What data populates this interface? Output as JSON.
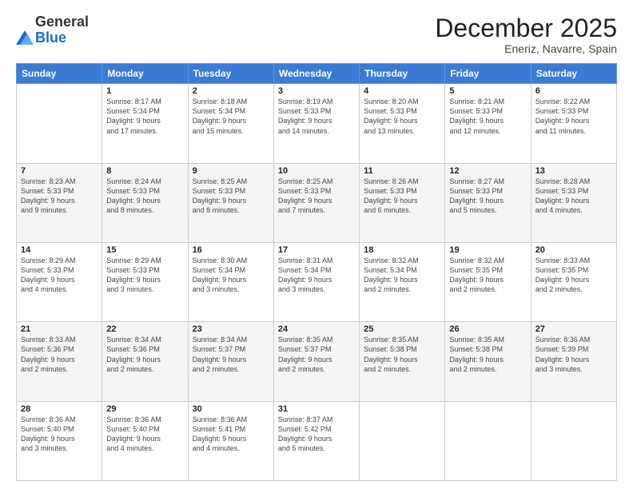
{
  "header": {
    "logo_general": "General",
    "logo_blue": "Blue",
    "month_title": "December 2025",
    "location": "Eneriz, Navarre, Spain"
  },
  "days_of_week": [
    "Sunday",
    "Monday",
    "Tuesday",
    "Wednesday",
    "Thursday",
    "Friday",
    "Saturday"
  ],
  "weeks": [
    [
      {
        "day": "",
        "info": ""
      },
      {
        "day": "1",
        "info": "Sunrise: 8:17 AM\nSunset: 5:34 PM\nDaylight: 9 hours\nand 17 minutes."
      },
      {
        "day": "2",
        "info": "Sunrise: 8:18 AM\nSunset: 5:34 PM\nDaylight: 9 hours\nand 15 minutes."
      },
      {
        "day": "3",
        "info": "Sunrise: 8:19 AM\nSunset: 5:33 PM\nDaylight: 9 hours\nand 14 minutes."
      },
      {
        "day": "4",
        "info": "Sunrise: 8:20 AM\nSunset: 5:33 PM\nDaylight: 9 hours\nand 13 minutes."
      },
      {
        "day": "5",
        "info": "Sunrise: 8:21 AM\nSunset: 5:33 PM\nDaylight: 9 hours\nand 12 minutes."
      },
      {
        "day": "6",
        "info": "Sunrise: 8:22 AM\nSunset: 5:33 PM\nDaylight: 9 hours\nand 11 minutes."
      }
    ],
    [
      {
        "day": "7",
        "info": "Sunrise: 8:23 AM\nSunset: 5:33 PM\nDaylight: 9 hours\nand 9 minutes."
      },
      {
        "day": "8",
        "info": "Sunrise: 8:24 AM\nSunset: 5:33 PM\nDaylight: 9 hours\nand 8 minutes."
      },
      {
        "day": "9",
        "info": "Sunrise: 8:25 AM\nSunset: 5:33 PM\nDaylight: 9 hours\nand 8 minutes."
      },
      {
        "day": "10",
        "info": "Sunrise: 8:25 AM\nSunset: 5:33 PM\nDaylight: 9 hours\nand 7 minutes."
      },
      {
        "day": "11",
        "info": "Sunrise: 8:26 AM\nSunset: 5:33 PM\nDaylight: 9 hours\nand 6 minutes."
      },
      {
        "day": "12",
        "info": "Sunrise: 8:27 AM\nSunset: 5:33 PM\nDaylight: 9 hours\nand 5 minutes."
      },
      {
        "day": "13",
        "info": "Sunrise: 8:28 AM\nSunset: 5:33 PM\nDaylight: 9 hours\nand 4 minutes."
      }
    ],
    [
      {
        "day": "14",
        "info": "Sunrise: 8:29 AM\nSunset: 5:33 PM\nDaylight: 9 hours\nand 4 minutes."
      },
      {
        "day": "15",
        "info": "Sunrise: 8:29 AM\nSunset: 5:33 PM\nDaylight: 9 hours\nand 3 minutes."
      },
      {
        "day": "16",
        "info": "Sunrise: 8:30 AM\nSunset: 5:34 PM\nDaylight: 9 hours\nand 3 minutes."
      },
      {
        "day": "17",
        "info": "Sunrise: 8:31 AM\nSunset: 5:34 PM\nDaylight: 9 hours\nand 3 minutes."
      },
      {
        "day": "18",
        "info": "Sunrise: 8:32 AM\nSunset: 5:34 PM\nDaylight: 9 hours\nand 2 minutes."
      },
      {
        "day": "19",
        "info": "Sunrise: 8:32 AM\nSunset: 5:35 PM\nDaylight: 9 hours\nand 2 minutes."
      },
      {
        "day": "20",
        "info": "Sunrise: 8:33 AM\nSunset: 5:35 PM\nDaylight: 9 hours\nand 2 minutes."
      }
    ],
    [
      {
        "day": "21",
        "info": "Sunrise: 8:33 AM\nSunset: 5:36 PM\nDaylight: 9 hours\nand 2 minutes."
      },
      {
        "day": "22",
        "info": "Sunrise: 8:34 AM\nSunset: 5:36 PM\nDaylight: 9 hours\nand 2 minutes."
      },
      {
        "day": "23",
        "info": "Sunrise: 8:34 AM\nSunset: 5:37 PM\nDaylight: 9 hours\nand 2 minutes."
      },
      {
        "day": "24",
        "info": "Sunrise: 8:35 AM\nSunset: 5:37 PM\nDaylight: 9 hours\nand 2 minutes."
      },
      {
        "day": "25",
        "info": "Sunrise: 8:35 AM\nSunset: 5:38 PM\nDaylight: 9 hours\nand 2 minutes."
      },
      {
        "day": "26",
        "info": "Sunrise: 8:35 AM\nSunset: 5:38 PM\nDaylight: 9 hours\nand 2 minutes."
      },
      {
        "day": "27",
        "info": "Sunrise: 8:36 AM\nSunset: 5:39 PM\nDaylight: 9 hours\nand 3 minutes."
      }
    ],
    [
      {
        "day": "28",
        "info": "Sunrise: 8:36 AM\nSunset: 5:40 PM\nDaylight: 9 hours\nand 3 minutes."
      },
      {
        "day": "29",
        "info": "Sunrise: 8:36 AM\nSunset: 5:40 PM\nDaylight: 9 hours\nand 4 minutes."
      },
      {
        "day": "30",
        "info": "Sunrise: 8:36 AM\nSunset: 5:41 PM\nDaylight: 9 hours\nand 4 minutes."
      },
      {
        "day": "31",
        "info": "Sunrise: 8:37 AM\nSunset: 5:42 PM\nDaylight: 9 hours\nand 5 minutes."
      },
      {
        "day": "",
        "info": ""
      },
      {
        "day": "",
        "info": ""
      },
      {
        "day": "",
        "info": ""
      }
    ]
  ]
}
